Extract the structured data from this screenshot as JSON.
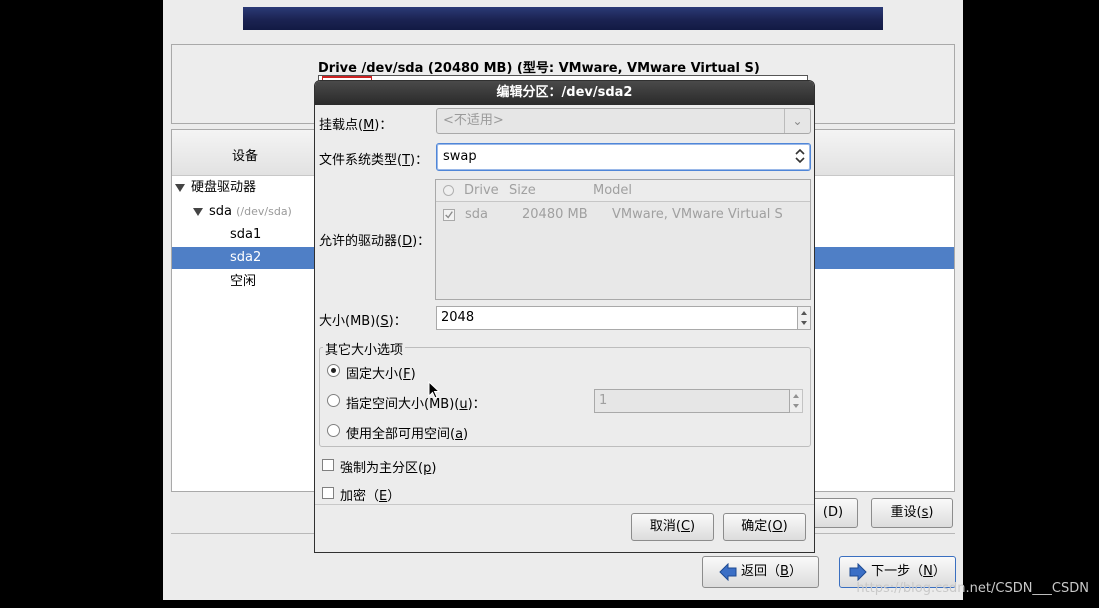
{
  "installer": {
    "drive_title": "Drive /dev/sda (20480 MB) (型号: VMware, VMware Virtual S)",
    "tree": {
      "header": "设备",
      "items": [
        {
          "label": "硬盘驱动器",
          "level": 0,
          "expanded": true
        },
        {
          "label": "sda",
          "sub": "(/dev/sda)",
          "level": 1,
          "expanded": true
        },
        {
          "label": "sda1",
          "level": 2
        },
        {
          "label": "sda2",
          "level": 2,
          "selected": true
        },
        {
          "label": "空闲",
          "level": 2
        }
      ]
    },
    "buttons": {
      "delete_suffix": "(D)",
      "reset": {
        "text": "重设(",
        "key": "s",
        "end": ")"
      },
      "back": {
        "text": "返回（",
        "key": "B",
        "end": "）"
      },
      "next": {
        "text": "下一步（",
        "key": "N",
        "end": "）"
      }
    }
  },
  "dialog": {
    "title": "编辑分区：/dev/sda2",
    "mount": {
      "label_pre": "挂载点(",
      "key": "M",
      "label_post": ")：",
      "value": "<不适用>"
    },
    "fstype": {
      "label_pre": "文件系统类型(",
      "key": "T",
      "label_post": ")：",
      "value": "swap"
    },
    "drives": {
      "label_pre": "允许的驱动器(",
      "key": "D",
      "label_post": ")：",
      "columns": [
        "Drive",
        "Size",
        "Model"
      ],
      "rows": [
        {
          "drive": "sda",
          "size": "20480 MB",
          "model": "VMware, VMware Virtual S",
          "checked": true
        }
      ]
    },
    "size": {
      "label_pre": "大小(MB)(",
      "key": "S",
      "label_post": ")：",
      "value": "2048"
    },
    "other_size": {
      "title": "其它大小选项",
      "fixed": {
        "pre": "固定大小(",
        "key": "F",
        "post": ")",
        "selected": true
      },
      "upto": {
        "pre": "指定空间大小(MB)(",
        "key": "u",
        "post": ")：",
        "value": "1"
      },
      "fill": {
        "pre": "使用全部可用空间(",
        "key": "a",
        "post": ")"
      }
    },
    "primary": {
      "pre": "強制为主分区(",
      "key": "p",
      "post": ")",
      "checked": false
    },
    "encrypt": {
      "pre": "加密（",
      "key": "E",
      "post": "）",
      "checked": false
    },
    "cancel": {
      "pre": "取消(",
      "key": "C",
      "post": ")"
    },
    "ok": {
      "pre": "确定(",
      "key": "O",
      "post": ")"
    }
  },
  "watermark": "https://blog.csdn.net/CSDN___CSDN"
}
